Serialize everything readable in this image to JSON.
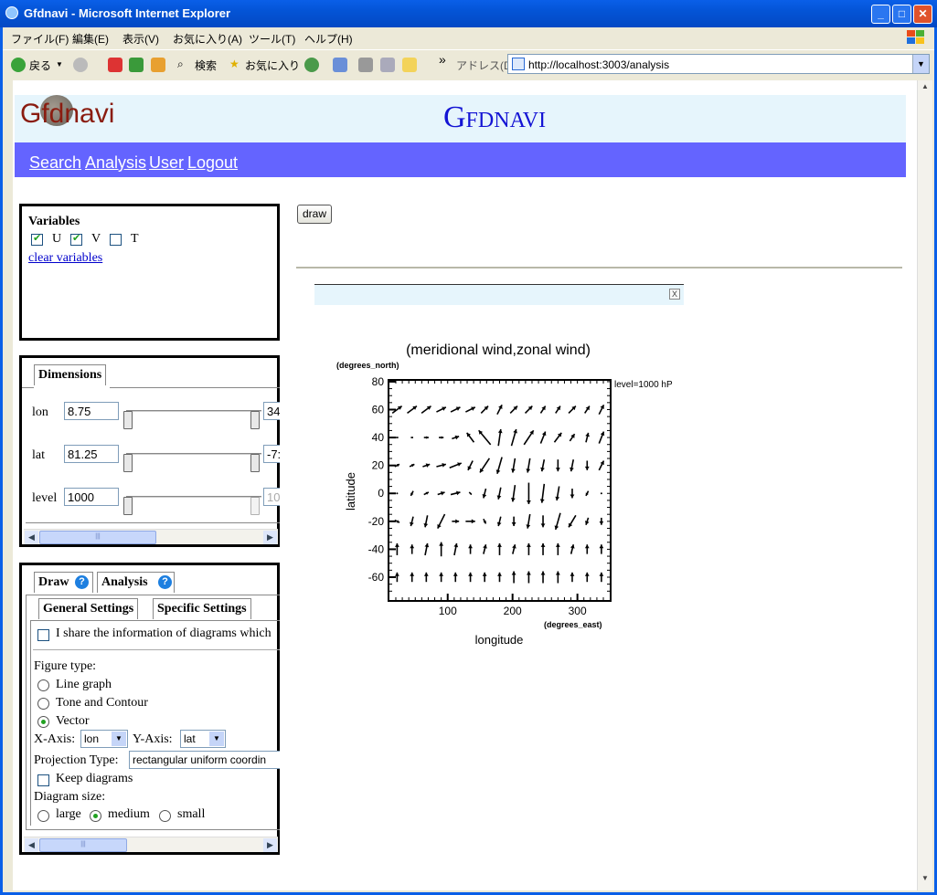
{
  "window": {
    "title": "Gfdnavi - Microsoft Internet Explorer"
  },
  "menu": [
    "ファイル(F)",
    "編集(E)",
    "表示(V)",
    "お気に入り(A)",
    "ツール(T)",
    "ヘルプ(H)"
  ],
  "toolbar": {
    "back": "戻る",
    "search": "検索",
    "favorites": "お気に入り",
    "more": "»",
    "address_label": "アドレス(D)"
  },
  "address": {
    "url": "http://localhost:3003/analysis"
  },
  "site": {
    "logo": "Gfdnavi",
    "title": "Gfdnavi"
  },
  "nav": [
    "Search",
    "Analysis",
    "User",
    "Logout"
  ],
  "variables": {
    "heading": "Variables",
    "items": [
      {
        "label": "U",
        "checked": true
      },
      {
        "label": "V",
        "checked": true
      },
      {
        "label": "T",
        "checked": false
      }
    ],
    "clear_link": "clear variables"
  },
  "dimensions": {
    "tab": "Dimensions",
    "rows": [
      {
        "name": "lon",
        "min": "8.75",
        "max": "34"
      },
      {
        "name": "lat",
        "min": "81.25",
        "max": "-7:"
      },
      {
        "name": "level",
        "min": "1000",
        "max": "10"
      }
    ]
  },
  "draw_panel": {
    "tabs": [
      "Draw",
      "Analysis"
    ],
    "subtabs": [
      "General Settings",
      "Specific Settings"
    ],
    "share_text": "I share the information of diagrams which",
    "figure_type_label": "Figure type:",
    "figure_types": [
      {
        "label": "Line graph",
        "selected": false
      },
      {
        "label": "Tone and Contour",
        "selected": false
      },
      {
        "label": "Vector",
        "selected": true
      }
    ],
    "x_axis_label": "X-Axis:",
    "x_axis_value": "lon",
    "y_axis_label": "Y-Axis:",
    "y_axis_value": "lat",
    "projection_label": "Projection Type:",
    "projection_value": "rectangular uniform coordin",
    "keep_label": "Keep diagrams",
    "size_label": "Diagram size:",
    "sizes": [
      {
        "label": "large",
        "selected": false
      },
      {
        "label": "medium",
        "selected": true
      },
      {
        "label": "small",
        "selected": false
      }
    ]
  },
  "draw_button": "draw",
  "figure_close": "X",
  "chart_data": {
    "type": "vector",
    "title": "(meridional wind,zonal wind)",
    "xlabel": "longitude",
    "xunits": "(degrees_east)",
    "ylabel": "latitude",
    "yunits": "(degrees_north)",
    "annotation": "level=1000 hP",
    "xlim": [
      8.75,
      351.25
    ],
    "ylim": [
      -77,
      81.25
    ],
    "xticks": [
      100,
      200,
      300
    ],
    "yticks": [
      80,
      60,
      40,
      20,
      0,
      -20,
      -40,
      -60
    ],
    "lons": [
      22,
      45,
      67,
      90,
      112,
      135,
      157,
      180,
      202,
      225,
      247,
      270,
      292,
      315,
      337
    ],
    "lats": [
      60,
      40,
      20,
      0,
      -20,
      -40,
      -60
    ],
    "vectors": {
      "60": [
        [
          4,
          3
        ],
        [
          4,
          3
        ],
        [
          4,
          3
        ],
        [
          4,
          2
        ],
        [
          4,
          2
        ],
        [
          4,
          2
        ],
        [
          3,
          3
        ],
        [
          2,
          4
        ],
        [
          3,
          3
        ],
        [
          3,
          3
        ],
        [
          2,
          3
        ],
        [
          2,
          3
        ],
        [
          3,
          3
        ],
        [
          2,
          3
        ],
        [
          2,
          4
        ]
      ],
      "40": [
        [
          1,
          0
        ],
        [
          1,
          0
        ],
        [
          2,
          0
        ],
        [
          2,
          0
        ],
        [
          3,
          1
        ],
        [
          -3,
          4
        ],
        [
          -5,
          6
        ],
        [
          1,
          7
        ],
        [
          2,
          7
        ],
        [
          4,
          6
        ],
        [
          2,
          5
        ],
        [
          3,
          4
        ],
        [
          2,
          3
        ],
        [
          1,
          4
        ],
        [
          2,
          5
        ]
      ],
      "20": [
        [
          2,
          1
        ],
        [
          2,
          1
        ],
        [
          3,
          1
        ],
        [
          4,
          1
        ],
        [
          5,
          2
        ],
        [
          -2,
          -4
        ],
        [
          -4,
          -6
        ],
        [
          -2,
          -7
        ],
        [
          -1,
          -6
        ],
        [
          -1,
          -6
        ],
        [
          -1,
          -5
        ],
        [
          0,
          -5
        ],
        [
          -1,
          -5
        ],
        [
          0,
          -4
        ],
        [
          2,
          4
        ]
      ],
      "0": [
        [
          0,
          0
        ],
        [
          -1,
          -2
        ],
        [
          2,
          1
        ],
        [
          3,
          1
        ],
        [
          4,
          1
        ],
        [
          1,
          -1
        ],
        [
          -1,
          -4
        ],
        [
          -1,
          -5
        ],
        [
          -1,
          -7
        ],
        [
          0,
          -9
        ],
        [
          -1,
          -8
        ],
        [
          -1,
          -6
        ],
        [
          0,
          -4
        ],
        [
          -1,
          -2
        ],
        [
          0,
          0
        ]
      ],
      "-20": [
        [
          2,
          -1
        ],
        [
          -1,
          -4
        ],
        [
          -1,
          -5
        ],
        [
          -3,
          -6
        ],
        [
          3,
          0
        ],
        [
          4,
          0
        ],
        [
          1,
          -2
        ],
        [
          -1,
          -4
        ],
        [
          0,
          -4
        ],
        [
          -1,
          -6
        ],
        [
          0,
          -5
        ],
        [
          -2,
          -7
        ],
        [
          -3,
          -5
        ],
        [
          -1,
          -3
        ],
        [
          0,
          -3
        ]
      ],
      "-40": [
        [
          0,
          5
        ],
        [
          0,
          4
        ],
        [
          1,
          5
        ],
        [
          0,
          6
        ],
        [
          1,
          5
        ],
        [
          0,
          4
        ],
        [
          1,
          4
        ],
        [
          0,
          5
        ],
        [
          1,
          4
        ],
        [
          0,
          5
        ],
        [
          0,
          5
        ],
        [
          0,
          5
        ],
        [
          1,
          4
        ],
        [
          0,
          4
        ],
        [
          0,
          4
        ]
      ],
      "-60": [
        [
          0,
          4
        ],
        [
          0,
          4
        ],
        [
          0,
          4
        ],
        [
          0,
          4
        ],
        [
          0,
          4
        ],
        [
          0,
          4
        ],
        [
          0,
          4
        ],
        [
          0,
          4
        ],
        [
          0,
          5
        ],
        [
          0,
          5
        ],
        [
          0,
          5
        ],
        [
          0,
          5
        ],
        [
          0,
          4
        ],
        [
          0,
          4
        ],
        [
          0,
          4
        ]
      ]
    }
  }
}
